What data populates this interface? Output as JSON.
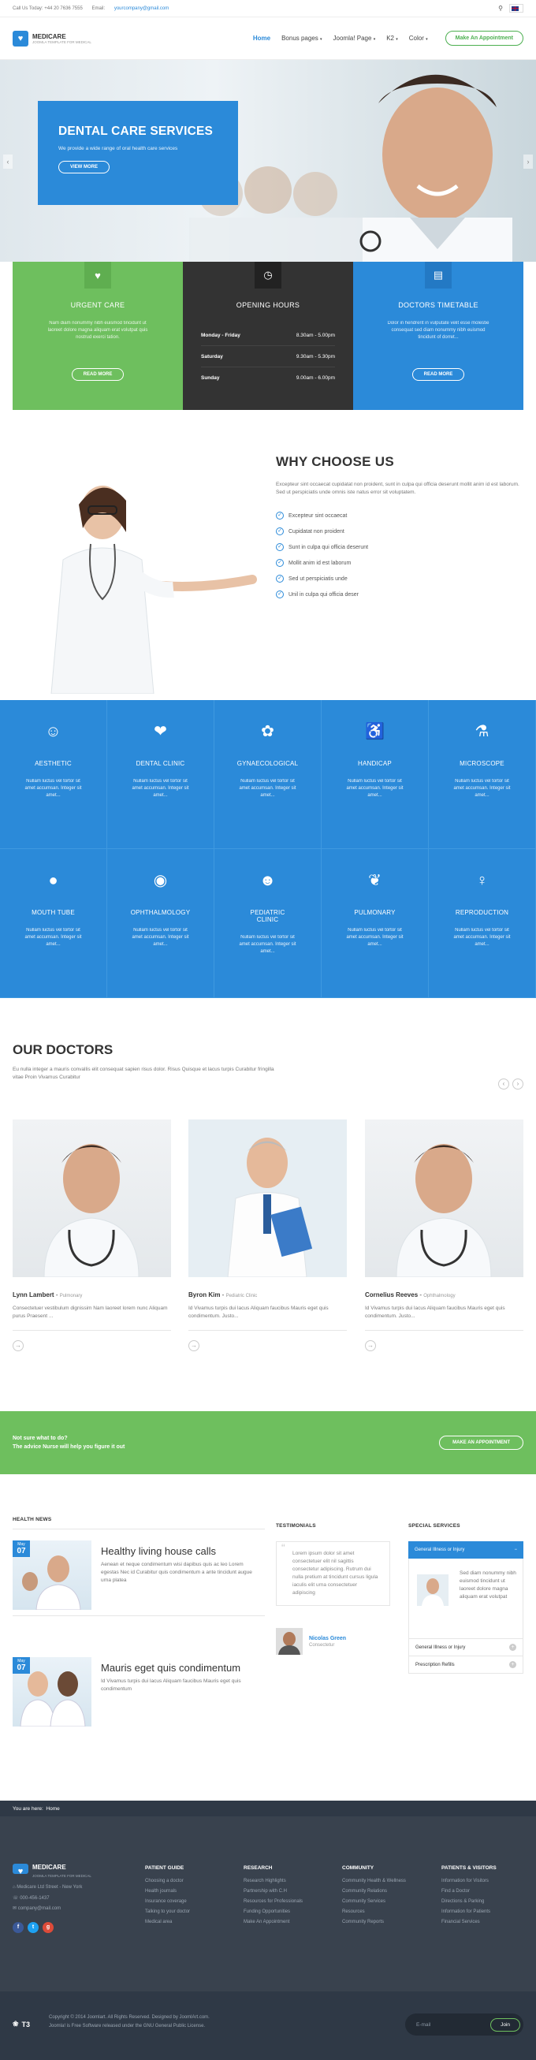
{
  "topbar": {
    "phone": "Call Us Today: +44 20 7636 7555",
    "email_label": "Email:",
    "email": "yourcompany@gmail.com"
  },
  "brand": {
    "name": "MEDICARE",
    "tagline": "JOOMLA TEMPLATE FOR MEDICAL"
  },
  "nav": {
    "items": [
      "Home",
      "Bonus pages",
      "Joomla! Page",
      "K2",
      "Color"
    ],
    "appointment": "Make An Appointment"
  },
  "hero": {
    "title": "DENTAL CARE SERVICES",
    "text": "We provide a wide range of oral health care services",
    "button": "VIEW MORE"
  },
  "features": {
    "urgent": {
      "title": "URGENT CARE",
      "text": "Nam diam nonummy nibh euismod tincidunt ut laoreet dolore magna aliquam erat volutpat quis nostrud exerci tation.",
      "button": "READ MORE"
    },
    "hours": {
      "title": "OPENING HOURS",
      "rows": [
        {
          "day": "Monday - Friday",
          "time": "8.30am - 5.00pm"
        },
        {
          "day": "Saturday",
          "time": "9.30am - 5.30pm"
        },
        {
          "day": "Sunday",
          "time": "9.00am - 6.00pm"
        }
      ]
    },
    "timetable": {
      "title": "DOCTORS TIMETABLE",
      "text": "Dolor in hendrerit in vulputate velit esse molestie consequat sed diam nonummy nibh euismod tincidunt of dorret...",
      "button": "READ MORE"
    }
  },
  "why": {
    "title": "WHY CHOOSE US",
    "desc": "Excepteur sint occaecat cupidatat non proident, sunt in culpa qui officia deserunt mollit anim id est laborum. Sed ut perspiciatis unde omnis iste natus error sit voluptatem.",
    "items": [
      "Excepteur sint occaecat",
      "Cupidatat non proident",
      "Sunt in culpa qui officia deserunt",
      "Mollit anim id est laborum",
      "Sed ut perspiciatis unde",
      "Unil in culpa qui officia deser"
    ]
  },
  "services": [
    {
      "name": "AESTHETIC",
      "icon": "face-icon",
      "text": "Nullam luctus vel tortor sit amet accumsan. Integer sit amet..."
    },
    {
      "name": "DENTAL CLINIC",
      "icon": "tooth-icon",
      "text": "Nullam luctus vel tortor sit amet accumsan. Integer sit amet..."
    },
    {
      "name": "GYNAECOLOGICAL",
      "icon": "fetus-icon",
      "text": "Nullam luctus vel tortor sit amet accumsan. Integer sit amet..."
    },
    {
      "name": "HANDICAP",
      "icon": "wheelchair-icon",
      "text": "Nullam luctus vel tortor sit amet accumsan. Integer sit amet..."
    },
    {
      "name": "MICROSCOPE",
      "icon": "microscope-icon",
      "text": "Nullam luctus vel tortor sit amet accumsan. Integer sit amet..."
    },
    {
      "name": "MOUTH TUBE",
      "icon": "head-icon",
      "text": "Nullam luctus vel tortor sit amet accumsan. Integer sit amet..."
    },
    {
      "name": "OPHTHALMOLOGY",
      "icon": "eye-icon",
      "text": "Nullam luctus vel tortor sit amet accumsan. Integer sit amet..."
    },
    {
      "name": "PEDIATRIC CLINIC",
      "icon": "baby-icon",
      "text": "Nullam luctus vel tortor sit amet accumsan. Integer sit amet..."
    },
    {
      "name": "PULMONARY",
      "icon": "lungs-icon",
      "text": "Nullam luctus vel tortor sit amet accumsan. Integer sit amet..."
    },
    {
      "name": "REPRODUCTION",
      "icon": "pregnant-icon",
      "text": "Nullam luctus vel tortor sit amet accumsan. Integer sit amet..."
    }
  ],
  "doctors": {
    "title": "OUR DOCTORS",
    "desc": "Eu nulla integer a mauris convallis elit consequat sapien risus dolor. Risus Quisque et lacus turpis Curabitur fringilla vitae Proin Vivamus Curabitur",
    "items": [
      {
        "name": "Lynn Lambert",
        "role": "Pulmonary",
        "bio": "Consectetuer vestibulum dignissim Nam laoreet lorem nunc Aliquam purus Praesent ..."
      },
      {
        "name": "Byron Kim",
        "role": "Pediatric Clinic",
        "bio": "Id Vivamus turpis dui lacus Aliquam faucibus Mauris eget quis condimentum. Justo..."
      },
      {
        "name": "Cornelius Reeves",
        "role": "Ophthalmology",
        "bio": "Id Vivamus turpis dui lacus Aliquam faucibus Mauris eget quis condimentum. Justo..."
      }
    ]
  },
  "cta": {
    "line1": "Not sure what to do?",
    "line2": "The advice Nurse will help you figure it out",
    "button": "MAKE AN APPOINTMENT"
  },
  "news": {
    "title": "HEALTH NEWS",
    "items": [
      {
        "month": "May",
        "day": "07",
        "title": "Healthy living house calls",
        "text": "Aenean et neque condimentum wisi dapibus quis ac leo Lorem egestas Nec id Curabitur quis condimentum a ante tincidunt augue urna platea"
      },
      {
        "month": "May",
        "day": "07",
        "title": "Mauris eget quis condimentum",
        "text": "Id Vivamus turpis dui lacus Aliquam faucibus Mauris eget quis condimentum"
      }
    ]
  },
  "testimonials": {
    "title": "TESTIMONIALS",
    "quote": "Lorem ipsum dolor sit amet consectetuer elit nil sagittis consectetur adipiscing. Rutrum dui nulla pretium at tincidunt cursus ligula iaculis elit urna consectetuer adipiscing",
    "name": "Nicolas Green",
    "role": "Consectetur"
  },
  "special": {
    "title": "SPECIAL SERVICES",
    "items": [
      "General Illness or Injury",
      "General Illness or Injury",
      "Prescription Refills"
    ],
    "text": "Sed diam nonummy nibh euismod tincidunt ut laoreet dolore magna aliquam erat volutpat"
  },
  "breadcrumb": {
    "label": "You are here:",
    "current": "Home"
  },
  "footer": {
    "address": "Medicare Ltd Street - New York",
    "phone": "000-456-1437",
    "email": "company@mail.com",
    "cols": [
      {
        "title": "PATIENT GUIDE",
        "items": [
          "Choosing a doctor",
          "Health journals",
          "Insurance coverage",
          "Talking to your doctor",
          "Medical area"
        ]
      },
      {
        "title": "RESEARCH",
        "items": [
          "Research Highlights",
          "Partnership with C.H",
          "Resources for Professionals",
          "Funding Opportunities",
          "Make An Appointment"
        ]
      },
      {
        "title": "COMMUNITY",
        "items": [
          "Community Health & Wellness",
          "Community Relations",
          "Community Services",
          "Resources",
          "Community Reports"
        ]
      },
      {
        "title": "PATIENTS & VISITORS",
        "items": [
          "Information for Visitors",
          "Find a Doctor",
          "Directions & Parking",
          "Information for Patients",
          "Financial Services"
        ]
      }
    ],
    "copyright": "Copyright © 2014 Joomlart. All Rights Reserved. Designed by JoomlArt.com.",
    "license": "Joomla! is Free Software released under the GNU General Public License.",
    "t3": "T3",
    "email_placeholder": "E-mail",
    "join": "Join"
  },
  "colors": {
    "blue": "#2b8ad9",
    "green": "#6ebf5e",
    "dark": "#333333",
    "footer": "#39424e"
  }
}
